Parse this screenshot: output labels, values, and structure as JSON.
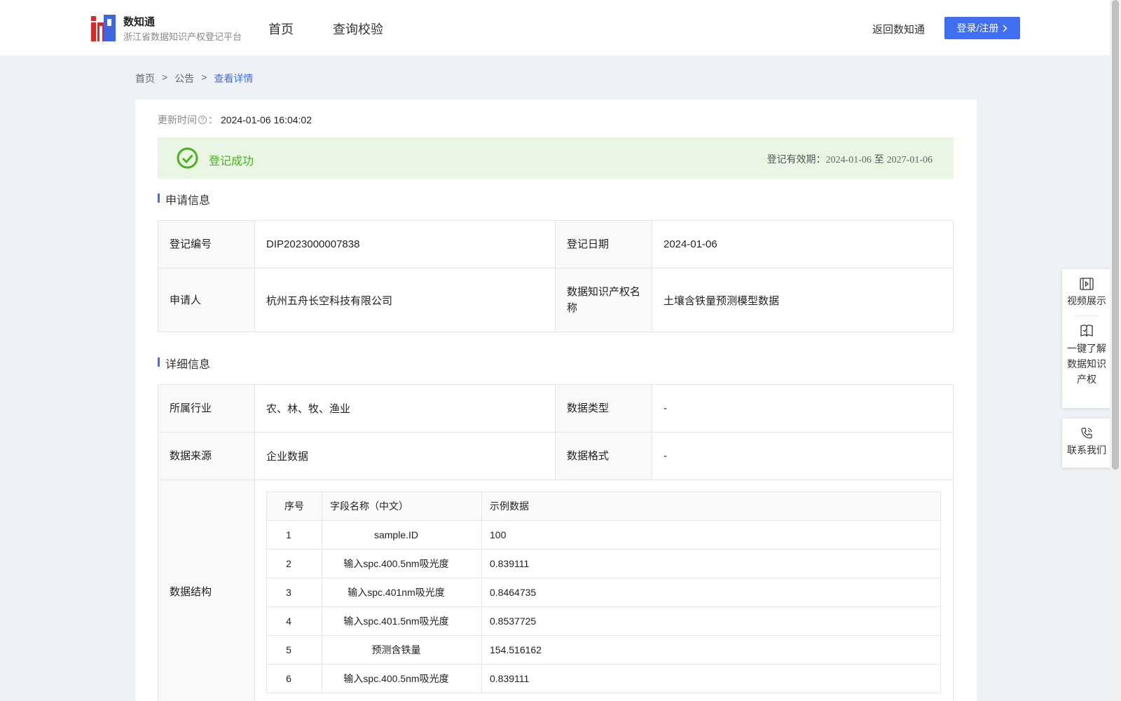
{
  "header": {
    "brand_name": "数知通",
    "brand_sub": "浙江省数据知识产权登记平台",
    "nav": [
      {
        "label": "首页"
      },
      {
        "label": "查询校验"
      }
    ],
    "back_link": "返回数知通",
    "login_label": "登录/注册"
  },
  "breadcrumb": {
    "items": [
      {
        "label": "首页"
      },
      {
        "label": "公告"
      }
    ],
    "separator": ">",
    "current": "查看详情"
  },
  "update": {
    "label": "更新时间",
    "q": "?",
    "colon": "：",
    "value": "2024-01-06 16:04:02"
  },
  "status": {
    "text": "登记成功",
    "validity_label": "登记有效期：",
    "validity_start": "2024-01-06",
    "validity_to": "至",
    "validity_end": "2027-01-06",
    "color": "#4bb21d"
  },
  "apply_info": {
    "title": "申请信息",
    "rows": [
      {
        "k1": "登记编号",
        "v1": "DIP2023000007838",
        "k2": "登记日期",
        "v2": "2024-01-06"
      },
      {
        "k1": "申请人",
        "v1": "杭州五舟长空科技有限公司",
        "k2": "数据知识产权名称",
        "v2": "土壤含铁量预测模型数据"
      }
    ]
  },
  "detail_info": {
    "title": "详细信息",
    "rows": [
      {
        "k1": "所属行业",
        "v1": "农、林、牧、渔业",
        "k2": "数据类型",
        "v2": "-"
      },
      {
        "k1": "数据来源",
        "v1": "企业数据",
        "k2": "数据格式",
        "v2": "-"
      }
    ],
    "structure_label": "数据结构",
    "structure_headers": [
      "序号",
      "字段名称（中文）",
      "示例数据"
    ],
    "structure_rows": [
      {
        "no": "1",
        "name": "sample.ID",
        "sample": "100"
      },
      {
        "no": "2",
        "name": "输入spc.400.5nm吸光度",
        "sample": "0.839111"
      },
      {
        "no": "3",
        "name": "输入spc.401nm吸光度",
        "sample": "0.8464735"
      },
      {
        "no": "4",
        "name": "输入spc.401.5nm吸光度",
        "sample": "0.8537725"
      },
      {
        "no": "5",
        "name": "预测含铁量",
        "sample": "154.516162"
      },
      {
        "no": "6",
        "name": "输入spc.400.5nm吸光度",
        "sample": "0.839111"
      }
    ]
  },
  "side_panel": {
    "video": "视频展示",
    "learn": [
      "一键了解",
      "数据知识",
      "产权"
    ],
    "contact": "联系我们"
  },
  "colors": {
    "accent": "#3f6ff0",
    "success": "#4bb21d",
    "success_bg": "#e8f6e3",
    "page_bg": "#eef1f5"
  }
}
